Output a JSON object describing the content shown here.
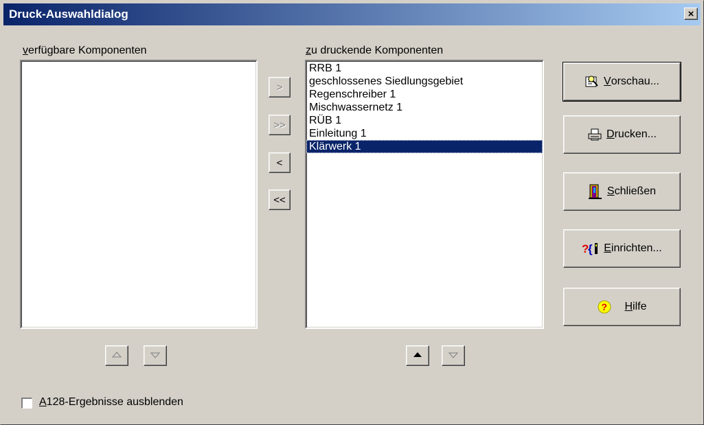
{
  "window": {
    "title": "Druck-Auswahldialog",
    "close_label": "×"
  },
  "available": {
    "label_first": "v",
    "label_rest": "erfügbare Komponenten",
    "items": []
  },
  "selected": {
    "label_first": "z",
    "label_rest": "u druckende Komponenten",
    "items": [
      "RRB 1",
      "geschlossenes Siedlungsgebiet",
      "Regenschreiber 1",
      "Mischwassernetz 1",
      "RÜB 1",
      "Einleitung 1",
      "Klärwerk 1"
    ],
    "selected_index": 6
  },
  "transfer_buttons": {
    "add": ">",
    "add_all": ">>",
    "remove": "<",
    "remove_all": "<<"
  },
  "actions": {
    "preview": {
      "mnemonic": "V",
      "rest": "orschau..."
    },
    "print": {
      "mnemonic": "D",
      "rest": "rucken..."
    },
    "close": {
      "mnemonic": "S",
      "rest": "chließen"
    },
    "setup": {
      "mnemonic": "E",
      "rest": "inrichten..."
    },
    "help": {
      "mnemonic": "H",
      "rest": "ilfe"
    }
  },
  "checkbox": {
    "mnemonic": "A",
    "rest": "128-Ergebnisse ausblenden",
    "checked": false
  },
  "colors": {
    "title_start": "#0a246a",
    "title_end": "#a6caf0",
    "selection": "#0a246a",
    "face": "#d4d0c8"
  }
}
